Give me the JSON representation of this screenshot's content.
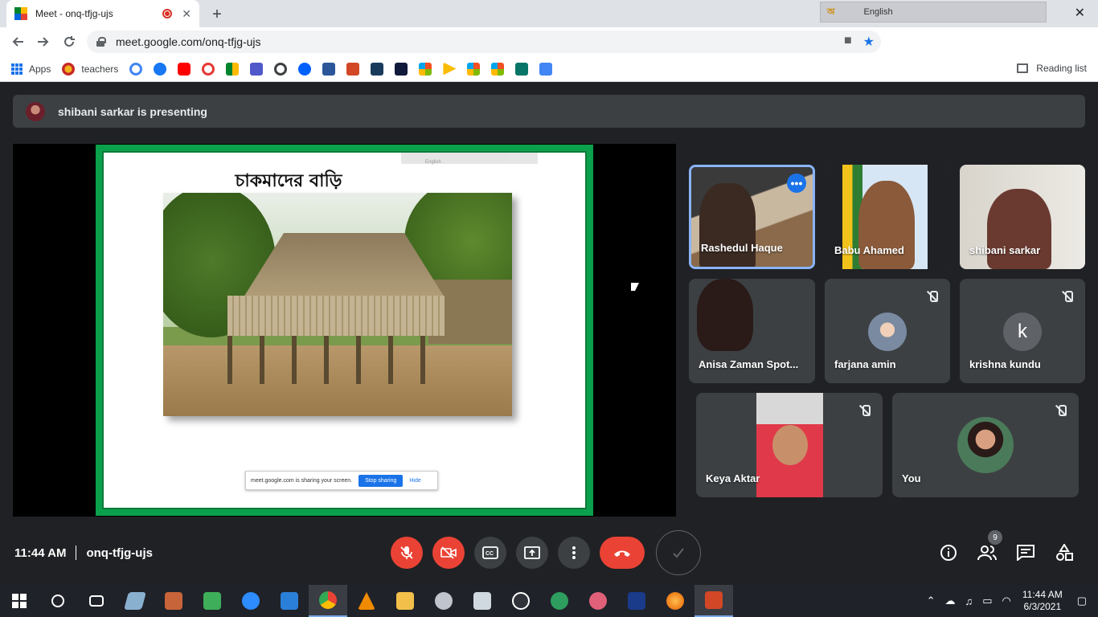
{
  "browser": {
    "tab_title": "Meet - onq-tfjg-ujs",
    "new_tab_symbol": "+",
    "close_symbol": "✕",
    "ime_lang": "English",
    "url": "meet.google.com/onq-tfjg-ujs",
    "bookmarks": {
      "apps_label": "Apps",
      "teachers_label": "teachers",
      "reading_list_label": "Reading list"
    }
  },
  "meet": {
    "presenting_text": "shibani sarkar is presenting",
    "slide_title": "চাকমাদের বাড়ি",
    "share_banner": {
      "message": "meet.google.com is sharing your screen.",
      "stop_label": "Stop sharing",
      "hide_label": "Hide"
    },
    "mini_ime_lang": "English",
    "participants": [
      {
        "name": "Rashedul Haque"
      },
      {
        "name": "Babu Ahamed"
      },
      {
        "name": "shibani sarkar"
      },
      {
        "name": "Anisa Zaman Spot..."
      },
      {
        "name": "farjana amin"
      },
      {
        "name": "krishna kundu",
        "initial": "k"
      },
      {
        "name": "Keya Aktar"
      },
      {
        "name": "You"
      }
    ],
    "time": "11:44 AM",
    "meeting_code": "onq-tfjg-ujs",
    "participant_count": "9"
  },
  "taskbar": {
    "time": "11:44 AM",
    "date": "6/3/2021"
  },
  "colors": {
    "meet_bg": "#202124",
    "tile_bg": "#3c4043",
    "danger_red": "#ea4335",
    "accent_blue": "#1a73e8",
    "slide_green": "#0aa04c"
  }
}
